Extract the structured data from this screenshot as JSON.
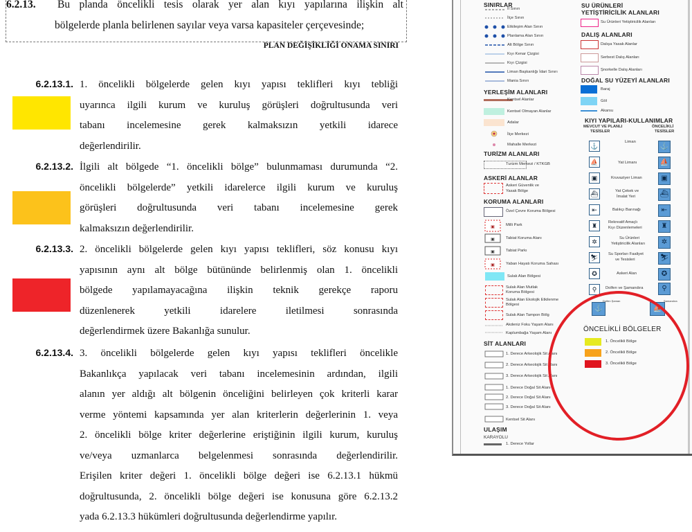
{
  "doc": {
    "top": {
      "number": "6.2.13.",
      "line1": "Bu planda öncelikli tesis olarak yer alan kıyı yapılarına ilişkin alt",
      "line2": "bölgelerde planla belirlenen sayılar veya varsa kapasiteler çerçevesinde;",
      "boundary": "PLAN DEĞİŞİKLİĞİ ONAMA SINIRI"
    },
    "articles": [
      {
        "number": "6.2.13.1.",
        "lines": [
          "1. öncelikli bölgelerde gelen kıyı yapısı teklifleri kıyı tebliği",
          "uyarınca ilgili kurum ve kuruluş görüşleri doğrultusunda veri",
          "tabanı incelemesine gerek kalmaksızın yetkili idarece",
          "değerlendirilir."
        ]
      },
      {
        "number": "6.2.13.2.",
        "lines": [
          "İlgili alt bölgede “1. öncelikli bölge” bulunmaması durumunda “2.",
          "öncelikli bölgelerde” yetkili idarelerce ilgili kurum ve kuruluş",
          "görüşleri doğrultusunda veri tabanı incelemesine gerek",
          "kalmaksızın değerlendirilir."
        ]
      },
      {
        "number": "6.2.13.3.",
        "lines": [
          "2. öncelikli bölgelerde gelen kıyı yapısı teklifleri, söz konusu kıyı",
          "yapısının aynı alt bölge bütününde belirlenmiş olan 1. öncelikli",
          "bölgede yapılamayacağına ilişkin teknik gerekçe raporu",
          "düzenlenerek yetkili idarelere iletilmesi sonrasında",
          "değerlendirmek üzere Bakanlığa sunulur."
        ]
      },
      {
        "number": "6.2.13.4.",
        "lines": [
          "3. öncelikli bölgelerde gelen kıyı yapısı teklifleri öncelikle",
          "Bakanlıkça yapılacak veri tabanı incelemesinin ardından, ilgili",
          "alanın yer aldığı alt bölgenin önceliğini belirleyen çok kriterli karar",
          "verme yöntemi kapsamında yer alan kriterlerin değerlerinin 1. veya",
          "2. öncelikli bölge kriter değerlerine eriştiğinin ilgili kurum, kuruluş",
          "ve/veya uzmanlarca belgelenmesi sonrasında değerlendirilir.",
          "Erişilen kriter değeri 1. öncelikli bölge değeri ise 6.2.13.1 hükmü",
          "doğrultusunda, 2. öncelikli bölge değeri ise konusuna göre 6.2.13.2",
          "yada 6.2.13.3 hükümleri doğrultusunda değerlendirme yapılır."
        ]
      }
    ],
    "swatch_colors": [
      "#ffe600",
      "#fcc21b",
      "#ee2429"
    ]
  },
  "legend": {
    "left": {
      "sinirlar": "SINIRLAR",
      "sinir_items": [
        "İl Sınırı",
        "İlçe Sınırı",
        "Etkileşim Alan Sınırı",
        "Planlama Alan Sınırı",
        "Alt Bölge Sınırı",
        "Kıyı Kenar Çizgisi",
        "Kıyı Çizgisi",
        "Liman Başkanlığı İdari Sınırı",
        "Mania Sınırı"
      ],
      "yerlesim": "YERLEŞİM ALANLARI",
      "yerlesim_items": [
        "Kentsel Alanlar",
        "Kentsel Olmayan Alanlar",
        "Adalar",
        "İlçe Merkezi",
        "Mahalle Merkezi"
      ],
      "turizm": "TURİZM ALANLARI",
      "turizm_items": [
        "Turizm Merkezi / KTKGB"
      ],
      "askeri": "ASKERİ ALANLAR",
      "askeri_items": [
        "Askeri Güvenlik ve",
        "Yasak Bölge"
      ],
      "koruma": "KORUMA ALANLARI",
      "koruma_items": [
        "Özel Çevre Koruma Bölgesi",
        "Milli Park",
        "Tabiat Koruma Alanı",
        "Tabiat Parkı",
        "Yaban Hayatı Koruma Sahası",
        "Sulak Alan Bölgesi",
        "Sulak Alan Mutlak",
        "Koruma Bölgesi",
        "Sulak Alan Ekolojik Etkilenme",
        "Bölgesi",
        "Sulak Alan Tampon Bölg",
        "Akdeniz Foku Yaşam Alanı",
        "Kaplumbağa Yaşam Alanı"
      ],
      "sit": "SİT ALANLARI",
      "sit_items": [
        "1. Derece Arkeolojik Sit Alanı",
        "2. Derece Arkeolojik Sit Alanı",
        "3. Derece Arkeolojik Sit Alanı",
        "1. Derece Doğal Sit Alanı",
        "2. Derece Doğal Sit Alanı",
        "3. Derece Doğal Sit Alanı",
        "Kentsel Sit Alanı"
      ],
      "ulasim": "ULAŞIM",
      "karayolu": "KARAYOLU",
      "ulasim_items": [
        "1. Derece Yollar"
      ]
    },
    "right": {
      "su_urunleri": "SU ÜRÜNLERİ",
      "su_urunleri2": "YETİŞTİRİCİLİK ALANLARI",
      "su_items": [
        "Su Ürünleri Yetiştiricilik Alanları"
      ],
      "dalis": "DALIŞ ALANLARI",
      "dalis_items": [
        "Dalışa Yasak Alanlar",
        "Serbest Dalış Alanları",
        "Şnorkelle Dalış Alanları"
      ],
      "dogal_su": "DOĞAL SU YÜZEYİ ALANLARI",
      "dogal_items": [
        "Baraj",
        "Göl",
        "Akarsu"
      ],
      "kiyi": "KIYI YAPILARI-KULLANIMLAR",
      "mevcut": "MEVCUT VE PLANLI",
      "mevcut2": "TESİSLER",
      "oncelikli": "ÖNCELİKLİ",
      "oncelikli2": "TESİSLER",
      "kiyi_items": [
        "Liman",
        "Yat Limanı",
        "Kruvaziyer Liman",
        "Yat Çekek ve",
        "İmalat Yeri",
        "Balıkçı Barınağı",
        "Rekreatif Amaçlı",
        "Kıyı Düzenlemeleri",
        "Su Ürünleri",
        "Yetiştiricilik Alanları",
        "Su Sporları Faaliyet",
        "ve Tesisleri",
        "Askeri Alan",
        "Dolfen ve Şamandıra"
      ],
      "small1": "Dolfen Şaman",
      "small2": "Şamandıra",
      "bolgeler": "ÖNCELİKLİ BÖLGELER",
      "bolge_items": [
        "1. Öncelikli Bölge",
        "2. Öncelikli Bölge",
        "3. Öncelikli Bölge"
      ],
      "colors": {
        "baraj": "#0a6fd6",
        "gol": "#7fd4f5",
        "akarsu": "#3b8fd6",
        "kentsel": "#b06b5a",
        "kentsel_olmayan": "#bff0df",
        "adalar": "#fbe4d0",
        "sulak": "#7fe7f5"
      }
    }
  }
}
